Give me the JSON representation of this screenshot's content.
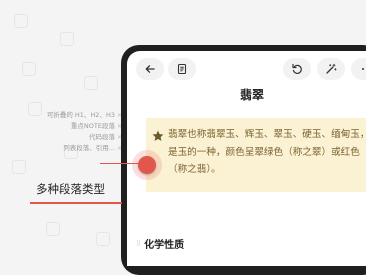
{
  "app": {
    "title": "翡翠"
  },
  "features": [
    {
      "label": "可折叠的 H1、H2、H3"
    },
    {
      "label": "重点NOTE段落"
    },
    {
      "label": "代码段落"
    },
    {
      "label": "列表段落、引用..."
    }
  ],
  "feature_close_glyph": "×",
  "callout": {
    "label": "多种段落类型",
    "accent": "#e2574c"
  },
  "toolbar": {
    "back_icon": "back-arrow-icon",
    "outline_icon": "document-outline-icon",
    "undo_icon": "undo-icon",
    "magic_icon": "magic-wand-icon",
    "more_icon": "more-icon"
  },
  "note": {
    "icon": "star-icon",
    "text": "翡翠也称翡翠玉、辉玉、翠玉、硬玉、缅甸玉，是玉的一种，颜色呈翠绿色（称之翠）或红色（称之翡）。",
    "background": "#fbf1d3",
    "star_color": "#6b5a2e"
  },
  "section": {
    "handle": "⠿",
    "heading": "化学性质"
  }
}
